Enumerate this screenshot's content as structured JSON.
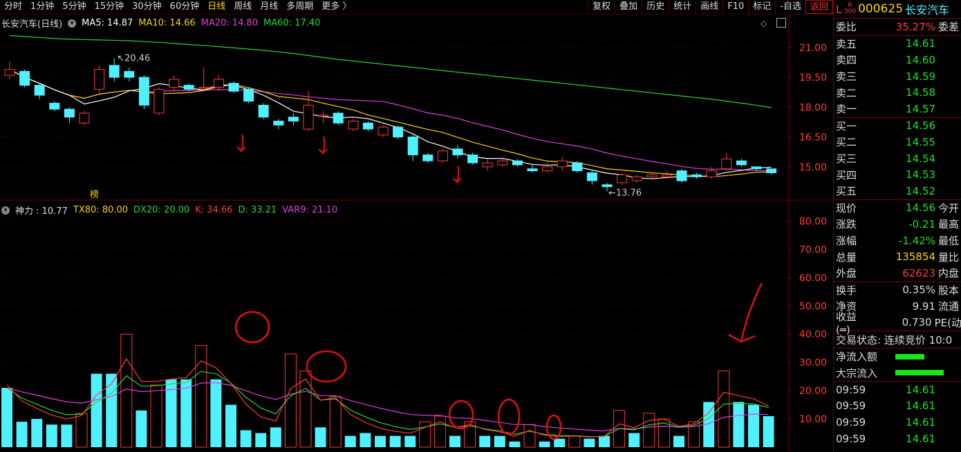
{
  "toolbar": {
    "tabs": [
      "分时",
      "1分钟",
      "5分钟",
      "15分钟",
      "30分钟",
      "60分钟",
      "日线",
      "周线",
      "月线",
      "多周期",
      "更多 〉"
    ],
    "active_tab": "日线",
    "right_buttons": [
      "复权",
      "叠加",
      "历史",
      "统计",
      "画线",
      "F10",
      "标记",
      "-自选",
      "返回"
    ]
  },
  "main_legend": {
    "title": "长安汽车(日线)",
    "ma5": "MA5: 14.87",
    "ma10": "MA10: 14.66",
    "ma20": "MA20: 14.80",
    "ma60": "MA60: 17.40"
  },
  "sub_legend": {
    "name": "神力 : 10.77",
    "tx80": "TX80: 80.00",
    "dx20": "DX20: 20.00",
    "k": "K: 34.66",
    "d": "D: 33.21",
    "var9": "VAR9: 21.10"
  },
  "annotations": {
    "high_label": "20.46",
    "low_label": "13.76",
    "bang_label": "榜"
  },
  "colors": {
    "up": "#ff3b3b",
    "down": "#4ff0ff",
    "ma5": "#ffffff",
    "ma10": "#ffd400",
    "ma20": "#e040e0",
    "ma60": "#2ed62e",
    "grid": "#7a0000"
  },
  "chart_data": [
    {
      "type": "candlestick",
      "title": "长安汽车(日线)",
      "y_ticks": [
        "21.00",
        "19.50",
        "18.00",
        "16.50",
        "15.00"
      ],
      "ylim": [
        13.5,
        22.0
      ],
      "candles": [
        [
          19.6,
          19.9,
          20.3,
          19.4
        ],
        [
          19.8,
          19.1,
          19.9,
          19.0
        ],
        [
          19.1,
          18.6,
          19.2,
          18.4
        ],
        [
          18.2,
          17.9,
          18.3,
          17.8
        ],
        [
          17.9,
          17.5,
          18.0,
          17.2
        ],
        [
          17.2,
          17.7,
          17.8,
          17.1
        ],
        [
          18.9,
          19.9,
          20.1,
          18.6
        ],
        [
          20.1,
          19.5,
          20.46,
          19.3
        ],
        [
          19.8,
          19.5,
          20.0,
          19.3
        ],
        [
          19.5,
          18.1,
          19.6,
          17.9
        ],
        [
          17.7,
          18.9,
          19.0,
          17.6
        ],
        [
          19.0,
          19.4,
          19.6,
          18.8
        ],
        [
          19.1,
          18.9,
          19.2,
          18.8
        ],
        [
          19.0,
          19.0,
          20.0,
          18.9
        ],
        [
          19.0,
          19.4,
          19.6,
          18.8
        ],
        [
          19.2,
          18.8,
          19.3,
          18.7
        ],
        [
          18.9,
          18.3,
          19.0,
          18.2
        ],
        [
          18.1,
          17.5,
          18.2,
          17.4
        ],
        [
          17.3,
          17.1,
          17.4,
          16.9
        ],
        [
          17.5,
          17.3,
          17.7,
          17.1
        ],
        [
          16.9,
          18.1,
          18.8,
          16.8
        ],
        [
          17.6,
          17.6,
          17.8,
          17.2
        ],
        [
          17.7,
          17.2,
          17.8,
          17.1
        ],
        [
          16.9,
          17.3,
          17.4,
          16.8
        ],
        [
          17.2,
          16.9,
          17.3,
          16.8
        ],
        [
          16.6,
          17.0,
          17.1,
          16.5
        ],
        [
          17.0,
          16.5,
          17.1,
          16.4
        ],
        [
          16.5,
          15.6,
          16.6,
          15.3
        ],
        [
          15.6,
          15.3,
          15.7,
          15.2
        ],
        [
          15.3,
          15.8,
          15.9,
          15.2
        ],
        [
          15.9,
          15.6,
          16.1,
          15.4
        ],
        [
          15.6,
          15.2,
          15.7,
          15.1
        ],
        [
          15.0,
          15.2,
          15.4,
          14.8
        ],
        [
          15.1,
          15.3,
          15.5,
          15.0
        ],
        [
          15.3,
          15.1,
          15.4,
          15.0
        ],
        [
          14.9,
          14.8,
          15.1,
          14.7
        ],
        [
          14.8,
          15.0,
          15.2,
          14.7
        ],
        [
          15.0,
          15.3,
          15.5,
          14.8
        ],
        [
          15.2,
          14.8,
          15.3,
          14.7
        ],
        [
          14.7,
          14.3,
          14.8,
          14.1
        ],
        [
          14.1,
          14.0,
          14.2,
          13.76
        ],
        [
          14.2,
          14.6,
          14.7,
          14.1
        ],
        [
          14.3,
          14.5,
          14.6,
          14.2
        ],
        [
          14.5,
          14.6,
          14.7,
          14.4
        ],
        [
          14.5,
          14.6,
          14.8,
          14.4
        ],
        [
          14.8,
          14.3,
          14.9,
          14.2
        ],
        [
          14.6,
          14.5,
          14.7,
          14.4
        ],
        [
          14.5,
          14.8,
          15.0,
          14.4
        ],
        [
          14.9,
          15.4,
          15.7,
          14.8
        ],
        [
          15.3,
          15.1,
          15.4,
          15.0
        ],
        [
          15.0,
          14.9,
          15.0,
          14.8
        ],
        [
          14.9,
          14.7,
          14.9,
          14.6
        ]
      ],
      "ma60": [
        21.6,
        21.55,
        21.5,
        21.45,
        21.42,
        21.4,
        21.38,
        21.36,
        21.34,
        21.3,
        21.26,
        21.2,
        21.15,
        21.1,
        21.04,
        20.98,
        20.92,
        20.85,
        20.78,
        20.7,
        20.6,
        20.5,
        20.4,
        20.32,
        20.24,
        20.16,
        20.08,
        20.0,
        19.92,
        19.84,
        19.76,
        19.68,
        19.6,
        19.52,
        19.44,
        19.36,
        19.28,
        19.2,
        19.12,
        19.04,
        18.96,
        18.88,
        18.8,
        18.72,
        18.64,
        18.56,
        18.48,
        18.4,
        18.3,
        18.2,
        18.1,
        17.98
      ]
    },
    {
      "type": "bar+line",
      "title": "神力",
      "y_ticks": [
        "80.00",
        "70.00",
        "60.00",
        "50.00",
        "40.00",
        "30.00",
        "20.00",
        "10.00"
      ],
      "ylim": [
        0,
        85
      ],
      "bars": [
        21,
        9,
        10,
        8,
        8,
        12,
        26,
        26,
        40,
        13,
        22,
        24,
        24,
        36,
        24,
        15,
        6,
        5,
        7,
        33,
        27,
        7,
        18,
        4,
        5,
        4,
        4,
        4,
        9,
        11,
        4,
        9,
        4,
        4,
        2,
        8,
        2,
        3,
        4,
        3,
        4,
        13,
        5,
        12,
        10,
        4,
        9,
        16,
        27,
        16,
        15,
        11
      ],
      "bar_up": [
        false,
        false,
        false,
        false,
        false,
        true,
        false,
        false,
        true,
        false,
        true,
        false,
        false,
        true,
        false,
        false,
        false,
        false,
        false,
        true,
        true,
        false,
        true,
        false,
        false,
        false,
        false,
        false,
        true,
        true,
        false,
        true,
        false,
        false,
        false,
        true,
        false,
        false,
        true,
        false,
        false,
        true,
        false,
        true,
        true,
        false,
        true,
        false,
        true,
        false,
        false,
        false
      ]
    }
  ],
  "quote_panel": {
    "code": "000625",
    "name": "长安汽车",
    "weibi_label": "委比",
    "weibi": "35.27%",
    "weicha_label": "委差",
    "asks": [
      {
        "label": "卖五",
        "price": "14.61"
      },
      {
        "label": "卖四",
        "price": "14.60"
      },
      {
        "label": "卖三",
        "price": "14.59"
      },
      {
        "label": "卖二",
        "price": "14.58"
      },
      {
        "label": "卖一",
        "price": "14.57"
      }
    ],
    "bids": [
      {
        "label": "买一",
        "price": "14.56"
      },
      {
        "label": "买二",
        "price": "14.55"
      },
      {
        "label": "买三",
        "price": "14.54"
      },
      {
        "label": "买四",
        "price": "14.53"
      },
      {
        "label": "买五",
        "price": "14.52"
      }
    ],
    "stats1": [
      {
        "label": "现价",
        "value": "14.56",
        "extra": "今开"
      },
      {
        "label": "涨跌",
        "value": "-0.21",
        "extra": "最高"
      },
      {
        "label": "涨幅",
        "value": "-1.42%",
        "extra": "最低"
      },
      {
        "label": "总量",
        "value": "135854",
        "extra": "量比"
      },
      {
        "label": "外盘",
        "value": "62623",
        "extra": "内盘"
      }
    ],
    "stats2": [
      {
        "label": "换手",
        "value": "0.35%",
        "extra": "股本"
      },
      {
        "label": "净资",
        "value": "9.91",
        "extra": "流通"
      },
      {
        "label": "收益(═)",
        "value": "0.730",
        "extra": "PE(动"
      }
    ],
    "trade_status": "交易状态: 连续竞价 10:0",
    "flows": [
      {
        "label": "净流入额"
      },
      {
        "label": "大宗流入"
      }
    ],
    "ticks": [
      {
        "time": "09:59",
        "price": "14.61"
      },
      {
        "time": "09:59",
        "price": "14.61"
      },
      {
        "time": "09:59",
        "price": "14.61"
      },
      {
        "time": "09:59",
        "price": "14.61"
      }
    ]
  }
}
